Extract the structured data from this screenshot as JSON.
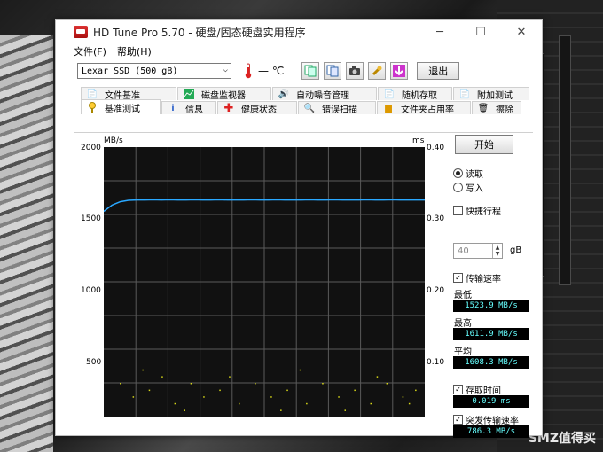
{
  "window": {
    "title": "HD Tune Pro 5.70 - 硬盘/固态硬盘实用程序"
  },
  "window_controls": {
    "minimize": "─",
    "maximize": "☐",
    "close": "✕"
  },
  "menu": {
    "file": "文件(F)",
    "help": "帮助(H)"
  },
  "toolbar": {
    "drive": "Lexar SSD (500 gB)",
    "temperature": "— ℃",
    "exit_label": "退出"
  },
  "tabs_top": [
    {
      "label": "文件基准"
    },
    {
      "label": "磁盘监视器"
    },
    {
      "label": "自动噪音管理"
    },
    {
      "label": "随机存取"
    },
    {
      "label": "附加测试"
    }
  ],
  "tabs_bottom": [
    {
      "label": "基准测试"
    },
    {
      "label": "信息"
    },
    {
      "label": "健康状态"
    },
    {
      "label": "错误扫描"
    },
    {
      "label": "文件夹占用率"
    },
    {
      "label": "擦除"
    }
  ],
  "side": {
    "start_label": "开始",
    "read_label": "读取",
    "write_label": "写入",
    "short_stroke_label": "快捷行程",
    "stroke_value": "40",
    "stroke_unit": "gB",
    "transfer_rate_label": "传输速率",
    "min_label": "最低",
    "min_value": "1523.9 MB/s",
    "max_label": "最高",
    "max_value": "1611.9 MB/s",
    "avg_label": "平均",
    "avg_value": "1608.3 MB/s",
    "access_time_label": "存取时间",
    "access_time_value": "0.019 ms",
    "burst_label": "突发传输速率",
    "burst_value": "786.3 MB/s"
  },
  "watermark": "SMZ值得买",
  "colors": {
    "line": "#2aa8ff",
    "scatter": "#d8d818",
    "chart_bg": "#111111",
    "readout_text": "#66ffff"
  },
  "chart_data": {
    "type": "line",
    "y_left_label": "MB/s",
    "y_right_label": "ms",
    "y_left_ticks": [
      "2000",
      "1500",
      "1000",
      "500"
    ],
    "y_right_ticks": [
      "0.40",
      "0.30",
      "0.20",
      "0.10"
    ],
    "ylim_left": [
      0,
      2000
    ],
    "ylim_right": [
      0,
      0.4
    ],
    "series": [
      {
        "values": [
          1523,
          1570,
          1595,
          1605,
          1608,
          1608,
          1609,
          1608,
          1609,
          1608,
          1608,
          1609,
          1608,
          1608,
          1609,
          1608,
          1608,
          1608,
          1609,
          1608,
          1608,
          1609,
          1608,
          1608,
          1608,
          1609,
          1608,
          1608,
          1609,
          1608,
          1608,
          1608,
          1609,
          1608,
          1608,
          1609,
          1608,
          1608,
          1608,
          1608
        ]
      }
    ],
    "access_points": [
      [
        0.05,
        0.05
      ],
      [
        0.09,
        0.03
      ],
      [
        0.14,
        0.04
      ],
      [
        0.18,
        0.06
      ],
      [
        0.22,
        0.02
      ],
      [
        0.27,
        0.05
      ],
      [
        0.31,
        0.03
      ],
      [
        0.36,
        0.04
      ],
      [
        0.42,
        0.02
      ],
      [
        0.47,
        0.05
      ],
      [
        0.52,
        0.03
      ],
      [
        0.57,
        0.04
      ],
      [
        0.63,
        0.02
      ],
      [
        0.68,
        0.05
      ],
      [
        0.73,
        0.03
      ],
      [
        0.78,
        0.04
      ],
      [
        0.83,
        0.02
      ],
      [
        0.88,
        0.05
      ],
      [
        0.93,
        0.03
      ],
      [
        0.97,
        0.04
      ],
      [
        0.12,
        0.07
      ],
      [
        0.39,
        0.06
      ],
      [
        0.61,
        0.07
      ],
      [
        0.85,
        0.06
      ],
      [
        0.25,
        0.01
      ],
      [
        0.55,
        0.01
      ],
      [
        0.75,
        0.01
      ],
      [
        0.95,
        0.02
      ]
    ]
  }
}
